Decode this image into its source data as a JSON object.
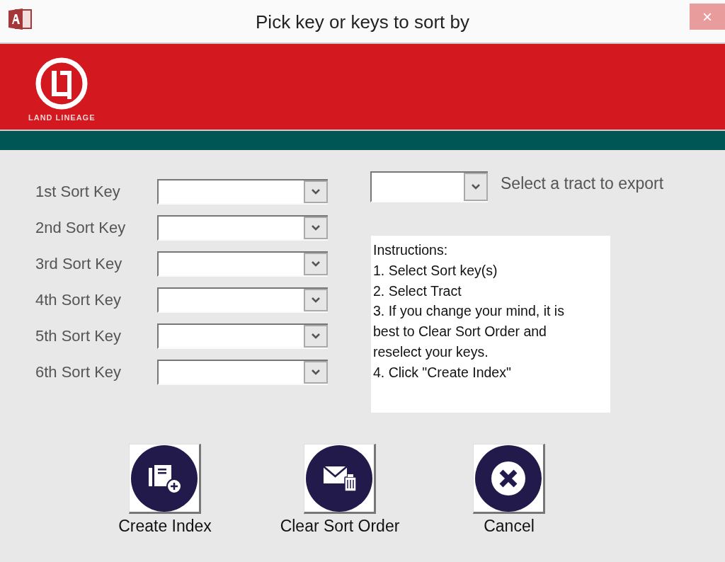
{
  "window": {
    "title": "Pick key or keys to sort by",
    "close": "×"
  },
  "banner": {
    "logo_text": "LAND LINEAGE"
  },
  "sort_keys": [
    {
      "label": "1st Sort Key"
    },
    {
      "label": "2nd Sort Key"
    },
    {
      "label": "3rd Sort Key"
    },
    {
      "label": "4th Sort Key"
    },
    {
      "label": "5th Sort Key"
    },
    {
      "label": "6th Sort Key"
    }
  ],
  "tract": {
    "label": "Select a tract to export"
  },
  "instructions": [
    "Instructions:",
    "1. Select Sort key(s)",
    "2. Select Tract",
    "3. If you change your mind, it is",
    "best to Clear Sort Order and",
    "reselect your keys.",
    "4. Click \"Create Index\""
  ],
  "buttons": [
    {
      "label": "Create Index",
      "kind": "create"
    },
    {
      "label": "Clear Sort Order",
      "kind": "clear"
    },
    {
      "label": "Cancel",
      "kind": "cancel"
    }
  ]
}
